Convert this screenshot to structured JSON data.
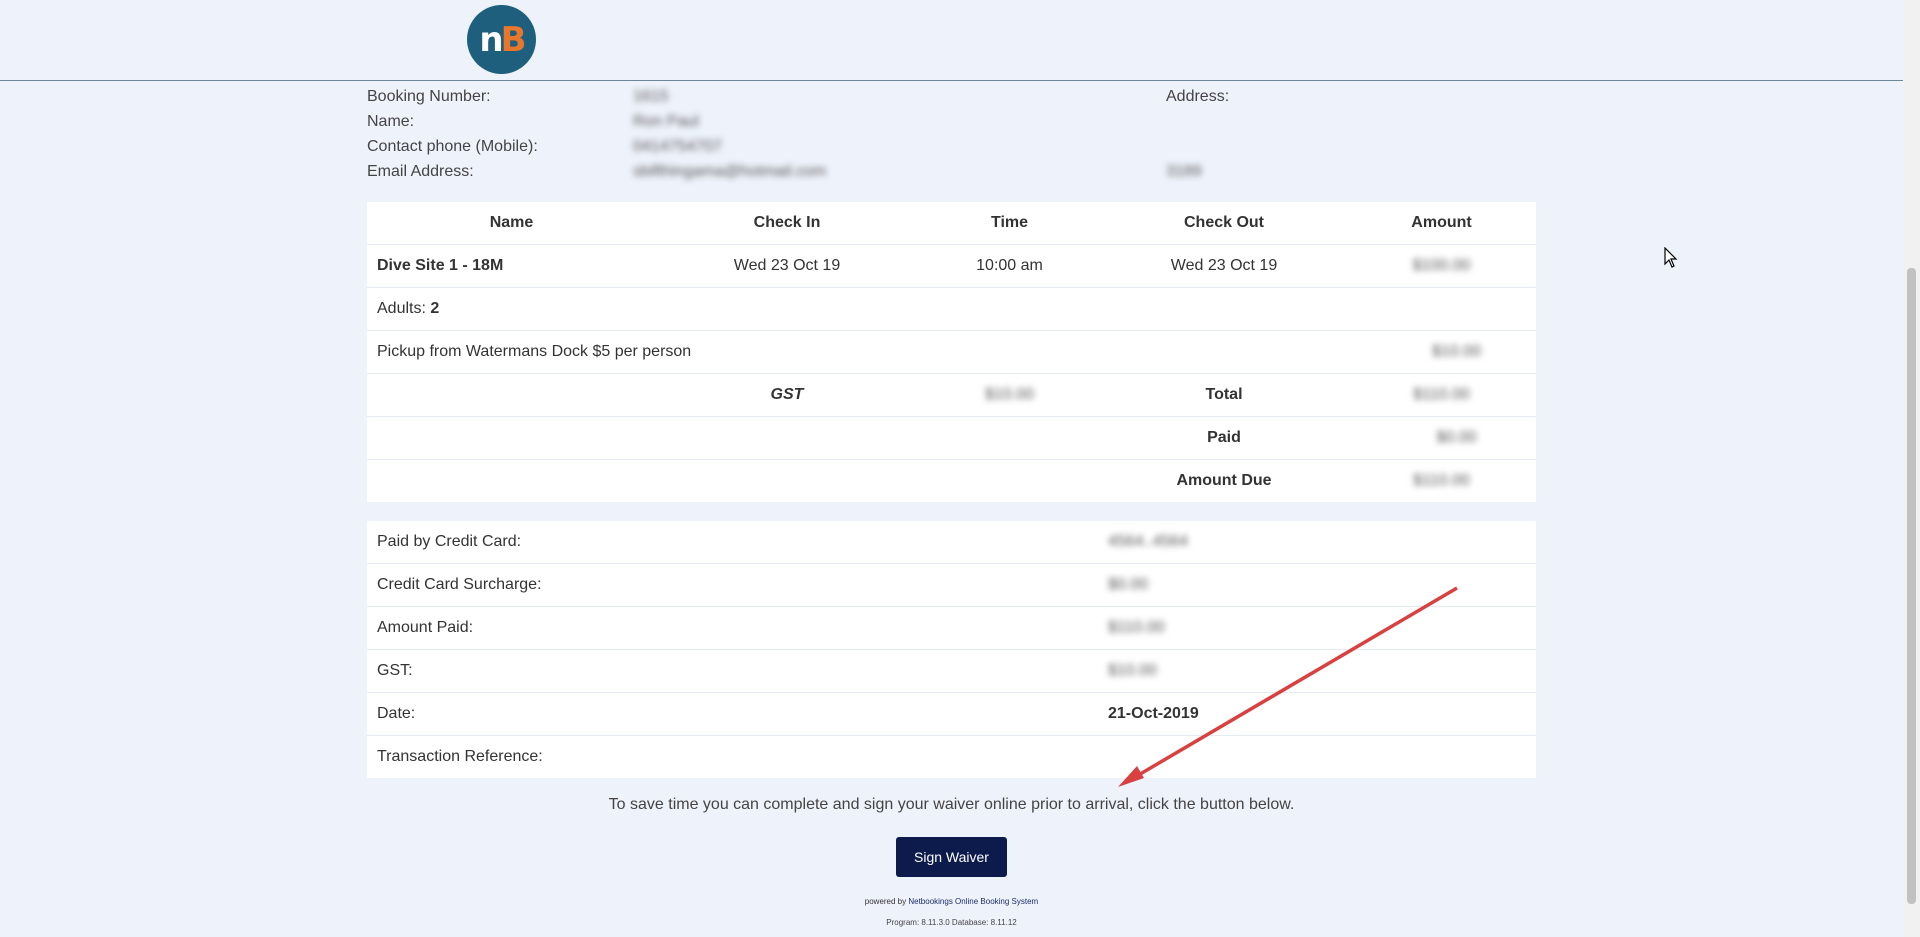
{
  "logo": {
    "n": "n",
    "b": "B"
  },
  "booking": {
    "number_label": "Booking Number:",
    "number_value": "1615",
    "name_label": "Name:",
    "name_value": "Ron Paul",
    "phone_label": "Contact phone (Mobile):",
    "phone_value": "0414754707",
    "email_label": "Email Address:",
    "email_value": "sbifthingama@hotmail.com",
    "address_label": "Address:",
    "address_value": "3189"
  },
  "table": {
    "headers": [
      "Name",
      "Check In",
      "Time",
      "Check Out",
      "Amount"
    ],
    "item": {
      "name": "Dive Site 1 - 18M",
      "check_in": "Wed 23 Oct 19",
      "time": "10:00 am",
      "check_out": "Wed 23 Oct 19",
      "amount": "$100.00"
    },
    "adults_label": "Adults:",
    "adults_value": "2",
    "pickup_label": "Pickup from Watermans Dock $5 per person",
    "pickup_amount": "$10.00",
    "gst_label": "GST",
    "gst_value": "$10.00",
    "total_label": "Total",
    "total_value": "$110.00",
    "paid_label": "Paid",
    "paid_value": "$0.00",
    "due_label": "Amount Due",
    "due_value": "$110.00"
  },
  "payment": {
    "card_label": "Paid by Credit Card:",
    "card_value": "4564..4564",
    "surcharge_label": "Credit Card Surcharge:",
    "surcharge_value": "$0.00",
    "amount_paid_label": "Amount Paid:",
    "amount_paid_value": "$110.00",
    "gst_label": "GST:",
    "gst_value": "$10.00",
    "date_label": "Date:",
    "date_value": "21-Oct-2019",
    "ref_label": "Transaction Reference:",
    "ref_value": ""
  },
  "waiver": {
    "note": "To save time you can complete and sign your waiver online prior to arrival, click the button below.",
    "button": "Sign Waiver"
  },
  "footer": {
    "powered_prefix": "powered by",
    "powered_link": "Netbookings Online Booking System",
    "version": "Program: 8.11.3.0 Database: 8.11.12"
  },
  "colors": {
    "background": "#eef3fb",
    "button": "#0d1b4c",
    "logo_bg": "#1f5f7e",
    "logo_accent": "#e8762b",
    "annotation_arrow": "#d94040"
  }
}
